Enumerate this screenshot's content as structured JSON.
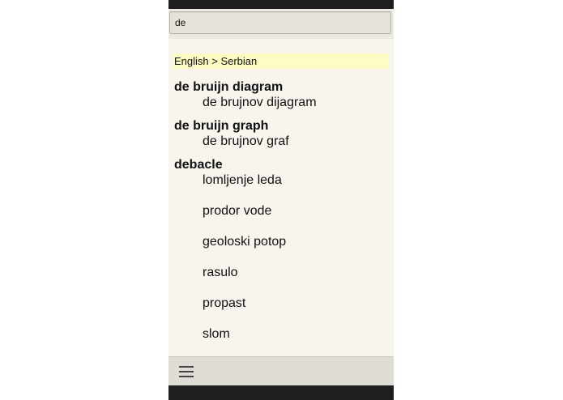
{
  "search": {
    "value": "de"
  },
  "results": {
    "language_header": "English > Serbian",
    "entries": [
      {
        "term": "de bruijn diagram",
        "translations": [
          "de brujnov dijagram"
        ]
      },
      {
        "term": "de bruijn graph",
        "translations": [
          "de brujnov graf"
        ]
      },
      {
        "term": "debacle",
        "translations": [
          "lomljenje leda",
          "prodor vode",
          "geoloski potop",
          "rasulo",
          "propast",
          "slom"
        ]
      }
    ]
  },
  "bottom_bar": {
    "menu_icon": "hamburger-menu-icon"
  },
  "colors": {
    "status_bar": "#1f1f1f",
    "background": "#f8f5ee",
    "language_header_bg": "#fdfcc2",
    "bottom_bar": "#e0ddd6"
  }
}
